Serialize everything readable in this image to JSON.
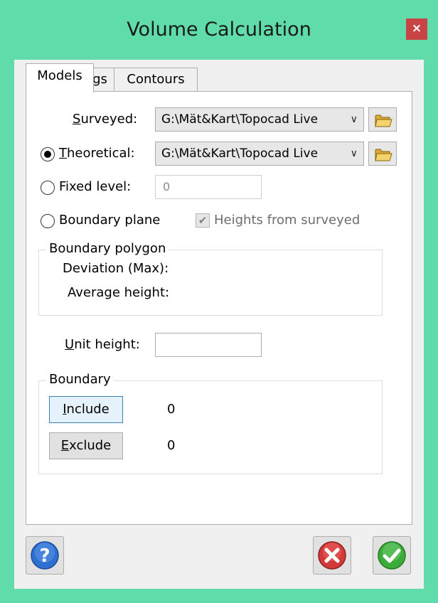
{
  "window": {
    "title": "Volume Calculation",
    "close_label": "×"
  },
  "tabs": [
    {
      "label": "Models",
      "active": true
    },
    {
      "label": "Settings",
      "active": false
    },
    {
      "label": "Contours",
      "active": false
    }
  ],
  "models": {
    "surveyed": {
      "label_u": "S",
      "label_rest": "urveyed:",
      "value": "G:\\Mät&Kart\\Topocad Live"
    },
    "theoretical": {
      "label_u": "T",
      "label_rest": "heoretical:",
      "value": "G:\\Mät&Kart\\Topocad Live",
      "selected": true
    },
    "fixed_level": {
      "label": "Fixed level:",
      "value": "0",
      "selected": false
    },
    "boundary_plane": {
      "label": "Boundary plane",
      "selected": false
    },
    "heights_from_surveyed": {
      "label": "Heights from surveyed",
      "checked": true,
      "check_glyph": "✔"
    },
    "boundary_polygon": {
      "title": "Boundary polygon",
      "deviation_label": "Deviation (Max):",
      "average_height_label": "Average height:"
    },
    "unit_height": {
      "label_u": "U",
      "label_rest": "nit height:",
      "value": ""
    },
    "boundary": {
      "title": "Boundary",
      "include": {
        "label_u": "I",
        "label_rest": "nclude",
        "count": "0"
      },
      "exclude": {
        "label_u": "E",
        "label_rest": "xclude",
        "count": "0"
      }
    }
  },
  "footer": {
    "help_icon": "help-icon",
    "cancel_icon": "cancel-icon",
    "ok_icon": "ok-icon"
  },
  "colors": {
    "frame": "#5fdcaa",
    "close": "#c94545",
    "focus": "#3c7fb1"
  }
}
